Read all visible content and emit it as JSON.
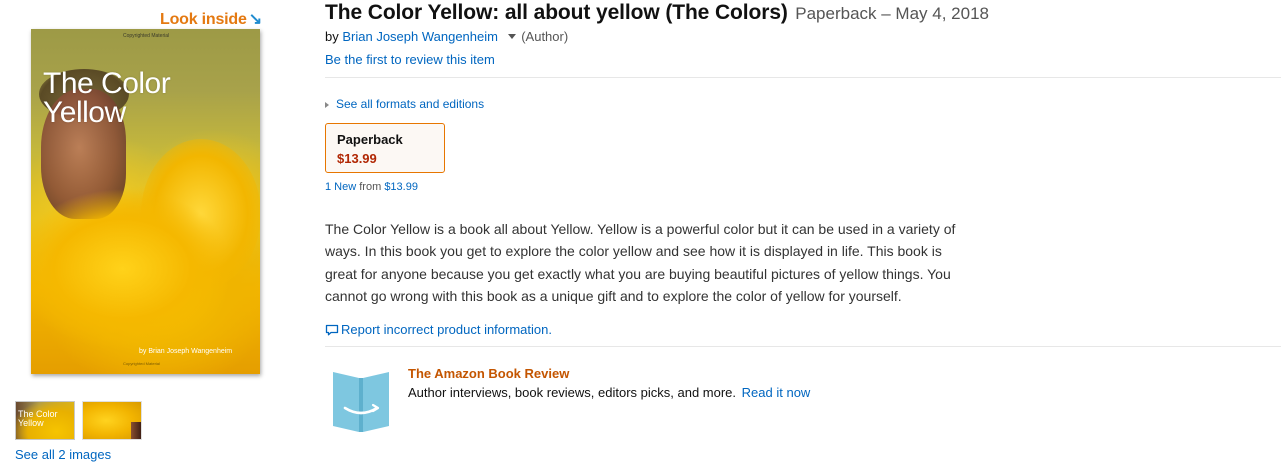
{
  "gallery": {
    "look_inside_label": "Look inside",
    "look_inside_arrow": "↘",
    "cover": {
      "top_small_text": "Copyrighted Material",
      "title_line1": "The Color",
      "title_line2": "Yellow",
      "author": "by Brian Joseph Wangenheim",
      "bottom_small_text": "Copyrighted Material"
    },
    "thumb1_text_line1": "The Color",
    "thumb1_text_line2": "Yellow",
    "see_all_images": "See all 2 images"
  },
  "product": {
    "title": "The Color Yellow: all about yellow (The Colors)",
    "subtitle": "Paperback – May 4, 2018",
    "by_prefix": "by",
    "author": "Brian Joseph Wangenheim",
    "author_role": "(Author)",
    "review_link": "Be the first to review this item",
    "formats_link": "See all formats and editions",
    "format": {
      "name": "Paperback",
      "price": "$13.99"
    },
    "new_from": {
      "count_label": "1 New",
      "from_word": "from",
      "price": "$13.99"
    },
    "description": "The Color Yellow is a book all about Yellow. Yellow is a powerful color but it can be used in a variety of ways. In this book you get to explore the color yellow and see how it is displayed in life. This book is great for anyone because you get exactly what you are buying beautiful pictures of yellow things. You cannot go wrong with this book as a unique gift and to explore the color of yellow for yourself.",
    "report_link": "Report incorrect product information."
  },
  "book_review": {
    "title": "The Amazon Book Review",
    "description": "Author interviews, book reviews, editors picks, and more.",
    "link": "Read it now"
  },
  "colors": {
    "link": "#0066c0",
    "price": "#b12704",
    "accent_orange": "#e77600",
    "review_title": "#c45500",
    "look_inside": "#e47911"
  },
  "icons": {
    "look_inside_arrow": "arrow-down-right-icon",
    "report": "speech-bubble-icon",
    "formats": "triangle-right-icon",
    "author_dropdown": "caret-down-icon",
    "book_review": "open-book-icon"
  }
}
